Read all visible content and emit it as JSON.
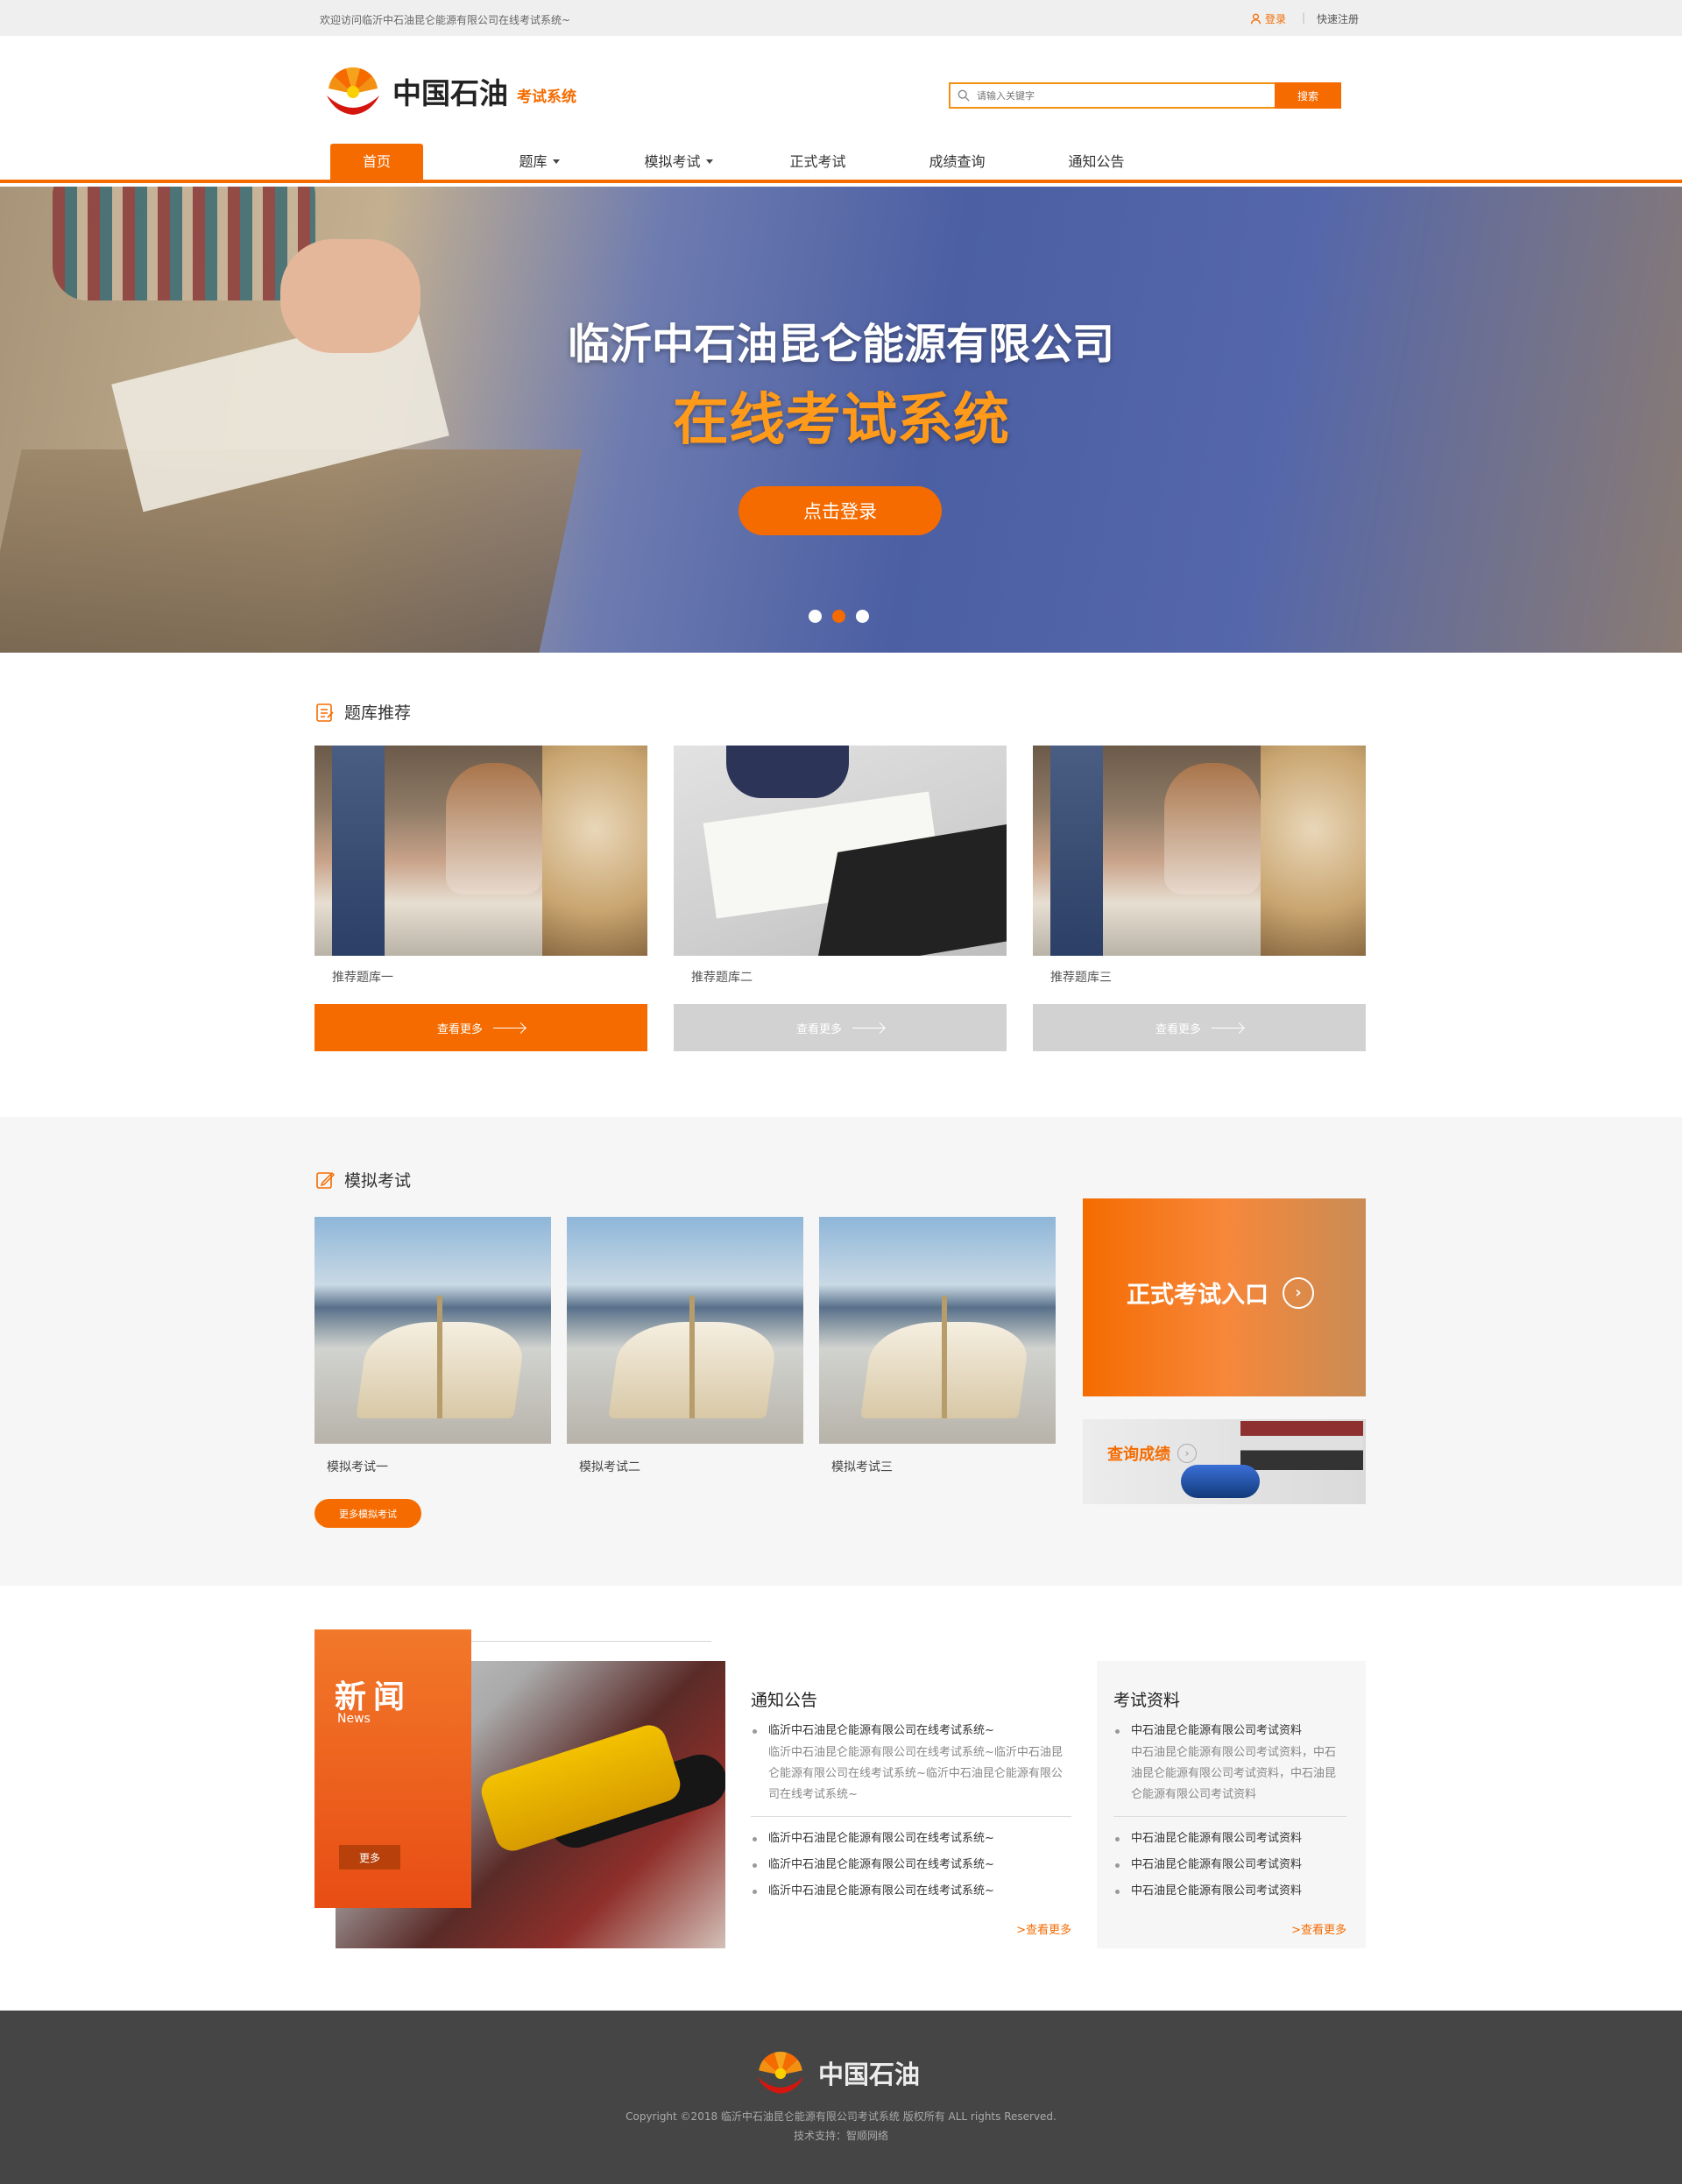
{
  "topbar": {
    "welcome": "欢迎访问临沂中石油昆仑能源有限公司在线考试系统~",
    "login": "登录",
    "register": "快速注册"
  },
  "brand": {
    "name": "中国石油",
    "system": "考试系统"
  },
  "search": {
    "placeholder": "请输入关键字",
    "button": "搜索"
  },
  "nav": {
    "items": [
      {
        "label": "首页",
        "active": true,
        "dropdown": false
      },
      {
        "label": "题库",
        "dropdown": true
      },
      {
        "label": "模拟考试",
        "dropdown": true
      },
      {
        "label": "正式考试",
        "dropdown": false
      },
      {
        "label": "成绩查询",
        "dropdown": false
      },
      {
        "label": "通知公告",
        "dropdown": false
      }
    ]
  },
  "hero": {
    "line1": "临沂中石油昆仑能源有限公司",
    "line2": "在线考试系统",
    "button": "点击登录",
    "slides": 3,
    "active_slide": 2
  },
  "bank": {
    "title": "题库推荐",
    "items": [
      {
        "caption": "推荐题库一",
        "more": "查看更多",
        "active": true
      },
      {
        "caption": "推荐题库二",
        "more": "查看更多",
        "active": false
      },
      {
        "caption": "推荐题库三",
        "more": "查看更多",
        "active": false
      }
    ]
  },
  "mock": {
    "title": "模拟考试",
    "items": [
      {
        "caption": "模拟考试一"
      },
      {
        "caption": "模拟考试二"
      },
      {
        "caption": "模拟考试三"
      }
    ],
    "more": "更多模拟考试",
    "entry": "正式考试入口",
    "score": "查询成绩"
  },
  "news": {
    "cn": "新闻",
    "en": "News",
    "more": "更多",
    "notice": {
      "title": "通知公告",
      "top": "临沂中石油昆仑能源有限公司在线考试系统~",
      "desc": "临沂中石油昆仑能源有限公司在线考试系统~临沂中石油昆仑能源有限公司在线考试系统~临沂中石油昆仑能源有限公司在线考试系统~",
      "items": [
        "临沂中石油昆仑能源有限公司在线考试系统~",
        "临沂中石油昆仑能源有限公司在线考试系统~",
        "临沂中石油昆仑能源有限公司在线考试系统~"
      ],
      "more": ">查看更多"
    },
    "material": {
      "title": "考试资料",
      "top": "中石油昆仑能源有限公司考试资料",
      "desc": "中石油昆仑能源有限公司考试资料，中石油昆仑能源有限公司考试资料，中石油昆仑能源有限公司考试资料",
      "items": [
        "中石油昆仑能源有限公司考试资料",
        "中石油昆仑能源有限公司考试资料",
        "中石油昆仑能源有限公司考试资料"
      ],
      "more": ">查看更多"
    }
  },
  "footer": {
    "name": "中国石油",
    "copyright": "Copyright ©2018 临沂中石油昆仑能源有限公司考试系统 版权所有 ALL rights Reserved.",
    "tech": "技术支持：智顺网络"
  },
  "colors": {
    "accent": "#f56b00",
    "gray_button": "#d2d2d2",
    "footer_bg": "#454545"
  }
}
